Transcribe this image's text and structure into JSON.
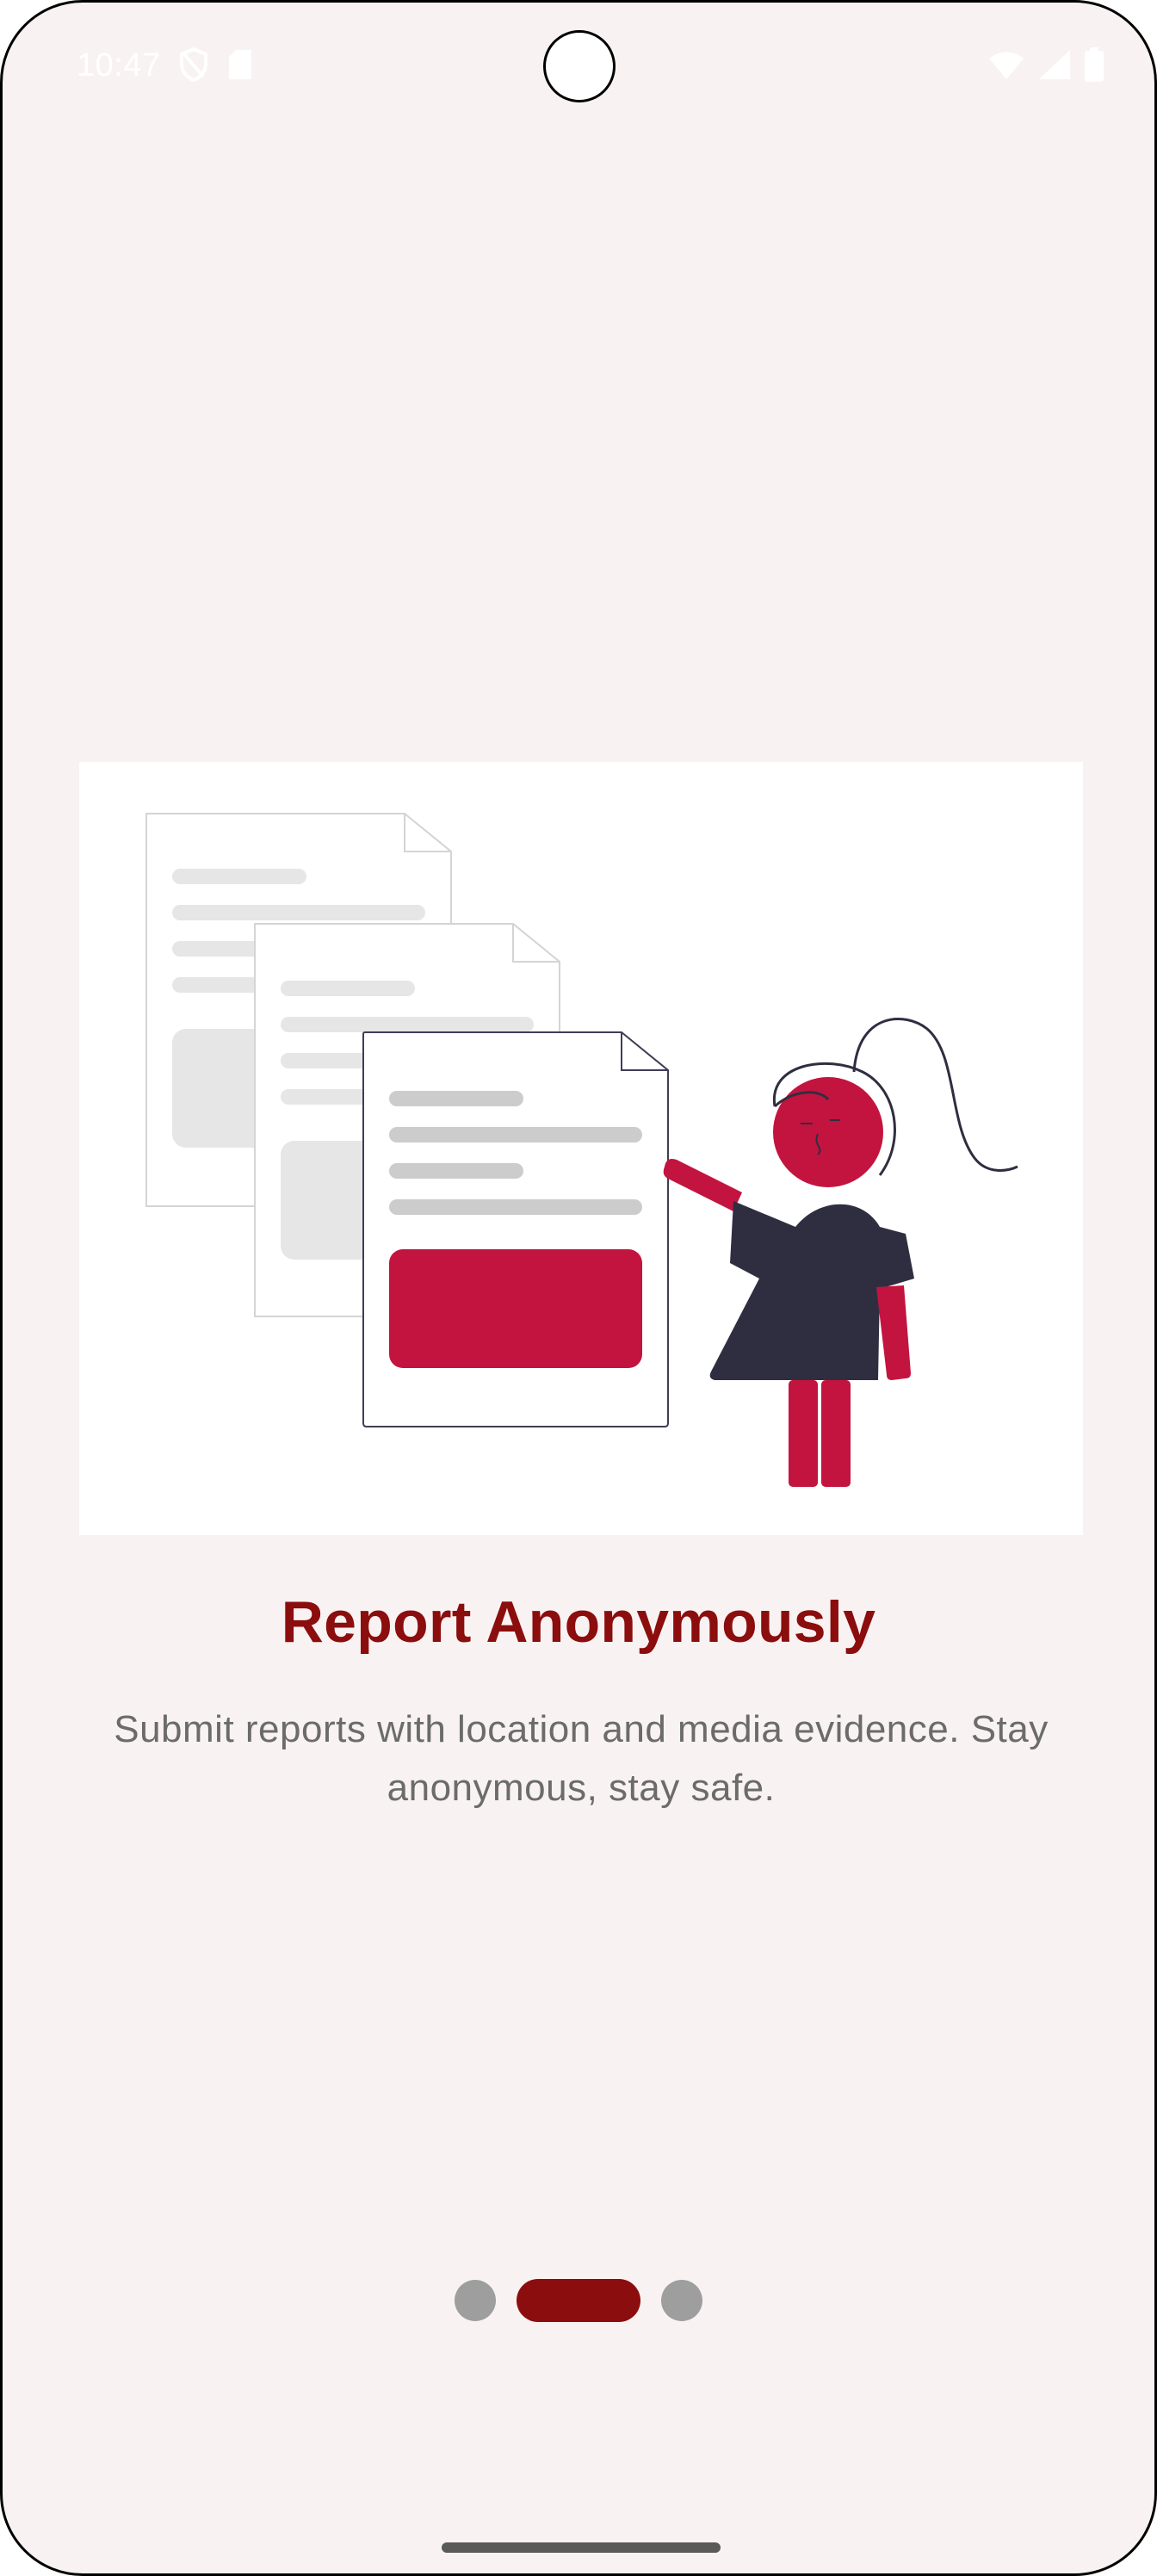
{
  "status_bar": {
    "time": "10:47",
    "left_icons": [
      "shield-icon",
      "sd-card-icon"
    ],
    "right_icons": [
      "wifi-icon",
      "signal-icon",
      "battery-icon"
    ]
  },
  "onboarding": {
    "illustration": "documents-woman-pointing-illustration",
    "title": "Report Anonymously",
    "description": "Submit reports with location and media evidence. Stay anonymous, stay safe."
  },
  "pager": {
    "page_count": 3,
    "current_page": 2
  },
  "colors": {
    "background": "#f9f2f2",
    "title": "#8b0d0d",
    "description": "#6b6b6b",
    "accent": "#c2143f",
    "figure_dark": "#2f2e41",
    "dot_inactive": "#9e9e9e",
    "dot_active": "#8b0d0d"
  }
}
